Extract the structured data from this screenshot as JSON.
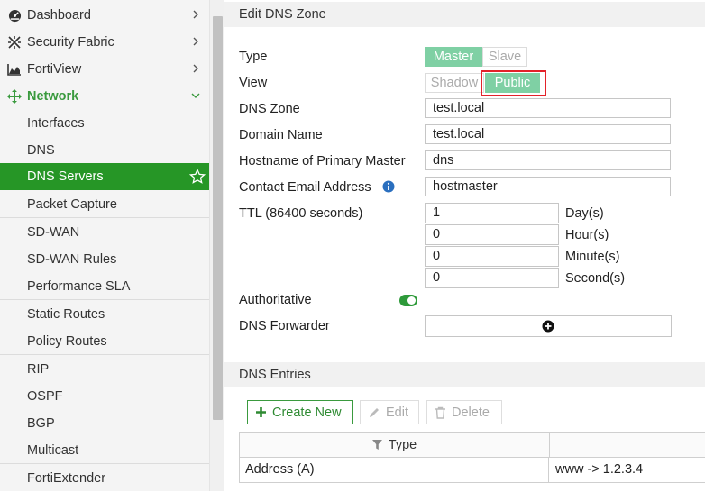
{
  "sidebar": {
    "items": [
      {
        "label": "Dashboard",
        "icon": "dashboard-icon"
      },
      {
        "label": "Security Fabric",
        "icon": "security-fabric-icon"
      },
      {
        "label": "FortiView",
        "icon": "fortiview-chart-icon"
      },
      {
        "label": "Network",
        "icon": "network-move-icon"
      },
      {
        "label": "Interfaces"
      },
      {
        "label": "DNS"
      },
      {
        "label": "DNS Servers"
      },
      {
        "label": "Packet Capture"
      },
      {
        "label": "SD-WAN"
      },
      {
        "label": "SD-WAN Rules"
      },
      {
        "label": "Performance SLA"
      },
      {
        "label": "Static Routes"
      },
      {
        "label": "Policy Routes"
      },
      {
        "label": "RIP"
      },
      {
        "label": "OSPF"
      },
      {
        "label": "BGP"
      },
      {
        "label": "Multicast"
      },
      {
        "label": "FortiExtender"
      }
    ],
    "active_item": "DNS Servers",
    "accent_color": "#269626"
  },
  "edit_zone": {
    "title": "Edit DNS Zone",
    "type_label": "Type",
    "type_options": [
      "Master",
      "Slave"
    ],
    "type_selected": "Master",
    "view_label": "View",
    "view_options": [
      "Shadow",
      "Public"
    ],
    "view_selected": "Public",
    "dns_zone_label": "DNS Zone",
    "dns_zone_value": "test.local",
    "domain_name_label": "Domain Name",
    "domain_name_value": "test.local",
    "hostname_label": "Hostname of Primary Master",
    "hostname_value": "dns",
    "contact_email_label": "Contact Email Address",
    "contact_email_value": "hostmaster",
    "ttl_label": "TTL (86400 seconds)",
    "ttl": [
      {
        "value": "1",
        "unit": "Day(s)"
      },
      {
        "value": "0",
        "unit": "Hour(s)"
      },
      {
        "value": "0",
        "unit": "Minute(s)"
      },
      {
        "value": "0",
        "unit": "Second(s)"
      }
    ],
    "authoritative_label": "Authoritative",
    "authoritative_enabled": true,
    "dns_forwarder_label": "DNS Forwarder"
  },
  "dns_entries": {
    "title": "DNS Entries",
    "create_new_label": "Create New",
    "edit_label": "Edit",
    "delete_label": "Delete",
    "columns": [
      "Type",
      ""
    ],
    "rows": [
      {
        "type": "Address (A)",
        "value": "www -> 1.2.3.4"
      }
    ]
  }
}
